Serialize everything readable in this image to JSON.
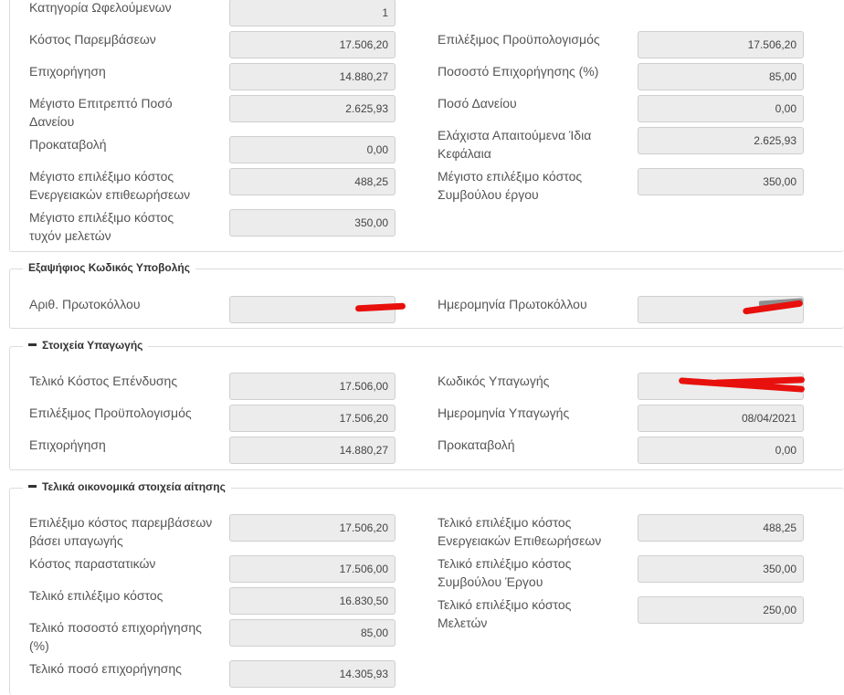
{
  "section1": {
    "rows_left": [
      {
        "label": "Κατηγορία Ωφελούμενων",
        "value": "1"
      },
      {
        "label": "Κόστος Παρεμβάσεων",
        "value": "17.506,20"
      },
      {
        "label": "Επιχορήγηση",
        "value": "14.880,27"
      },
      {
        "label": "Μέγιστο Επιτρεπτό Ποσό Δανείου",
        "value": "2.625,93"
      },
      {
        "label": "Προκαταβολή",
        "value": "0,00"
      },
      {
        "label": "Μέγιστο επιλέξιμο κόστος Ενεργειακών επιθεωρήσεων",
        "value": "488,25"
      },
      {
        "label": "Μέγιστο επιλέξιμο κόστος τυχόν μελετών",
        "value": "350,00"
      }
    ],
    "rows_right": [
      {
        "label": "Επιλέξιμος Προϋπολογισμός",
        "value": "17.506,20"
      },
      {
        "label": "Ποσοστό Επιχορήγησης (%)",
        "value": "85,00"
      },
      {
        "label": "Ποσό Δανείου",
        "value": "0,00"
      },
      {
        "label": "Ελάχιστα Απαιτούμενα Ίδια Κεφάλαια",
        "value": "2.625,93"
      },
      {
        "label": "Μέγιστο επιλέξιμο κόστος Συμβούλου έργου",
        "value": "350,00"
      }
    ]
  },
  "section2": {
    "legend": "Εξαψήφιος Κωδικός Υποβολής",
    "left": {
      "label": "Αριθ. Πρωτοκόλλου",
      "value": ""
    },
    "right": {
      "label": "Ημερομηνία Πρωτοκόλλου",
      "value": ""
    }
  },
  "section3": {
    "legend": "Στοιχεία Υπαγωγής",
    "rows_left": [
      {
        "label": "Τελικό Κόστος Επένδυσης",
        "value": "17.506,00"
      },
      {
        "label": "Επιλέξιμος Προϋπολογισμός",
        "value": "17.506,20"
      },
      {
        "label": "Επιχορήγηση",
        "value": "14.880,27"
      }
    ],
    "rows_right": [
      {
        "label": "Κωδικός Υπαγωγής",
        "value": ""
      },
      {
        "label": "Ημερομηνία Υπαγωγής",
        "value": "08/04/2021"
      },
      {
        "label": "Προκαταβολή",
        "value": "0,00"
      }
    ]
  },
  "section4": {
    "legend": "Τελικά οικονομικά στοιχεία αίτησης",
    "rows_left": [
      {
        "label": "Επιλέξιμο κόστος παρεμβάσεων βάσει υπαγωγής",
        "value": "17.506,20"
      },
      {
        "label": "Κόστος παραστατικών",
        "value": "17.506,00"
      },
      {
        "label": "Τελικό επιλέξιμο κόστος",
        "value": "16.830,50"
      },
      {
        "label": "Τελικό ποσοστό επιχορήγησης (%)",
        "value": "85,00"
      },
      {
        "label": "Τελικό ποσό επιχορήγησης",
        "value": "14.305,93"
      }
    ],
    "rows_right": [
      {
        "label": "Τελικό επιλέξιμο κόστος Ενεργειακών Επιθεωρήσεων",
        "value": "488,25"
      },
      {
        "label": "Τελικό επιλέξιμο κόστος Συμβούλου Έργου",
        "value": "350,00"
      },
      {
        "label": "Τελικό επιλέξιμο κόστος Μελετών",
        "value": "250,00"
      }
    ]
  },
  "colors": {
    "redaction": "#e8100c",
    "field_bg": "#ececec",
    "border": "#dcdcdc"
  }
}
